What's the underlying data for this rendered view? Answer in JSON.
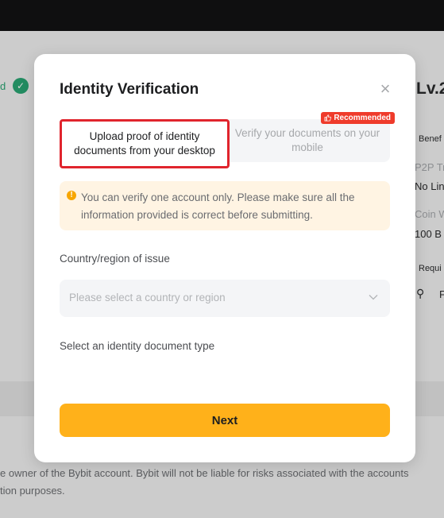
{
  "background": {
    "left_item_text": "d",
    "level_label": "Lv.2",
    "benefits_label": "Benef",
    "p2p_label": "P2P Tr",
    "no_limit_text": "No Lin",
    "coin_label": "Coin W",
    "coin_value": "100 B",
    "requirements_label": "Requi",
    "req_item": "F",
    "footer_line1": "e owner of the Bybit account. Bybit will not be liable for risks associated with the accounts",
    "footer_line2": "tion purposes."
  },
  "modal": {
    "title": "Identity Verification",
    "close_symbol": "×",
    "tabs": [
      {
        "label": "Upload proof of identity documents from your desktop",
        "selected": true
      },
      {
        "label": "Verify your documents on your mobile",
        "selected": false
      }
    ],
    "recommended_badge": "Recommended",
    "notice": {
      "icon_symbol": "!",
      "text": "You can verify one account only. Please make sure all the information provided is correct before submitting."
    },
    "country_label": "Country/region of issue",
    "country_placeholder": "Please select a country or region",
    "doc_type_label": "Select an identity document type",
    "next_label": "Next"
  },
  "colors": {
    "accent": "#ffb11a",
    "highlight_border": "#e0242d",
    "badge": "#ef3b2b",
    "notice_bg": "#fff4e3",
    "success": "#2aa774"
  }
}
